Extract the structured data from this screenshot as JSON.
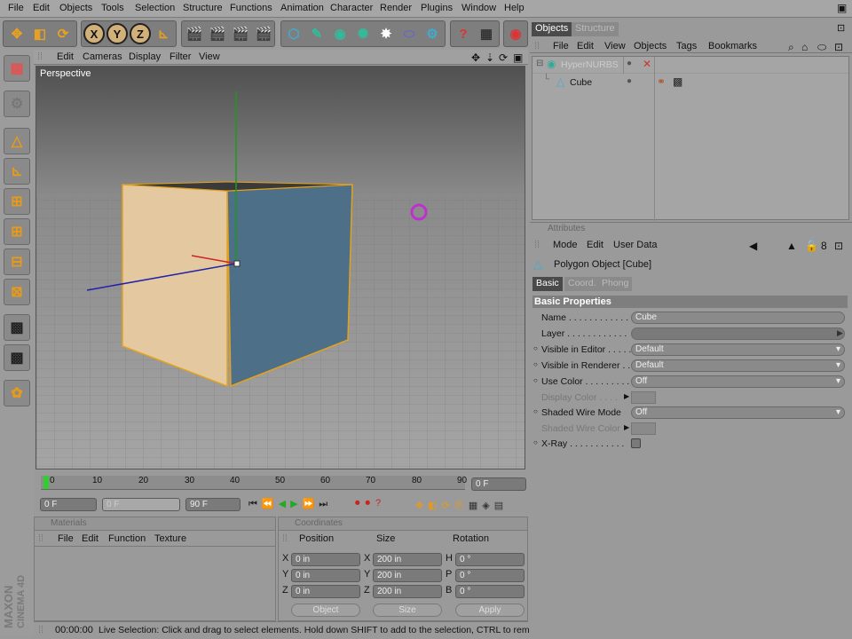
{
  "menubar": [
    "File",
    "Edit",
    "Objects",
    "Tools",
    "Selection",
    "Structure",
    "Functions",
    "Animation",
    "Character",
    "Render",
    "Plugins",
    "Window",
    "Help"
  ],
  "toolbar": {
    "x_label": "X",
    "y_label": "Y",
    "z_label": "Z"
  },
  "viewport": {
    "menu": [
      "Edit",
      "Cameras",
      "Display",
      "Filter",
      "View"
    ],
    "label": "Perspective"
  },
  "timeline": {
    "ticks": [
      "0",
      "10",
      "20",
      "30",
      "40",
      "50",
      "60",
      "70",
      "80",
      "90"
    ],
    "current_frame": "0 F",
    "start_field": "0 F",
    "min_field": "0 F",
    "end_field": "90 F"
  },
  "materials": {
    "title": "Materials",
    "menu": [
      "File",
      "Edit",
      "Function",
      "Texture"
    ]
  },
  "coordinates": {
    "title": "Coordinates",
    "columns": [
      "Position",
      "Size",
      "Rotation"
    ],
    "rows": [
      {
        "axis": "X",
        "pos": "0 in",
        "size_axis": "X",
        "size": "200 in",
        "rot_axis": "H",
        "rot": "0 °"
      },
      {
        "axis": "Y",
        "pos": "0 in",
        "size_axis": "Y",
        "size": "200 in",
        "rot_axis": "P",
        "rot": "0 °"
      },
      {
        "axis": "Z",
        "pos": "0 in",
        "size_axis": "Z",
        "size": "200 in",
        "rot_axis": "B",
        "rot": "0 °"
      }
    ],
    "mode_select": "Object",
    "size_select": "Size",
    "apply_label": "Apply"
  },
  "status": {
    "time": "00:00:00",
    "message": "Live Selection: Click and drag to select elements. Hold down SHIFT to add to the selection, CTRL to remove."
  },
  "objects_panel": {
    "tabs": [
      "Objects",
      "Structure"
    ],
    "menu": [
      "File",
      "Edit",
      "View",
      "Objects",
      "Tags",
      "Bookmarks"
    ],
    "items": [
      {
        "name": "HyperNURBS"
      },
      {
        "name": "Cube"
      }
    ]
  },
  "attributes": {
    "title": "Attributes",
    "menu": [
      "Mode",
      "Edit",
      "User Data"
    ],
    "object_title": "Polygon Object [Cube]",
    "tabs": [
      "Basic",
      "Coord.",
      "Phong"
    ],
    "section": "Basic Properties",
    "rows": [
      {
        "label": "Name . . . . . . . . . . . .",
        "value": "Cube"
      },
      {
        "label": "Layer . . . . . . . . . . . .",
        "value": ""
      },
      {
        "label": "Visible in Editor . . . . .",
        "value": "Default"
      },
      {
        "label": "Visible in Renderer . . .",
        "value": "Default"
      },
      {
        "label": "Use Color . . . . . . . . .",
        "value": "Off"
      },
      {
        "label": "Display Color . . . .",
        "value": ""
      },
      {
        "label": "Shaded Wire Mode",
        "value": "Off"
      },
      {
        "label": "Shaded Wire Color",
        "value": ""
      },
      {
        "label": "X-Ray . . . . . . . . . . .",
        "value": ""
      }
    ]
  },
  "branding": {
    "line1": "MAXON",
    "line2": "CINEMA 4D"
  }
}
